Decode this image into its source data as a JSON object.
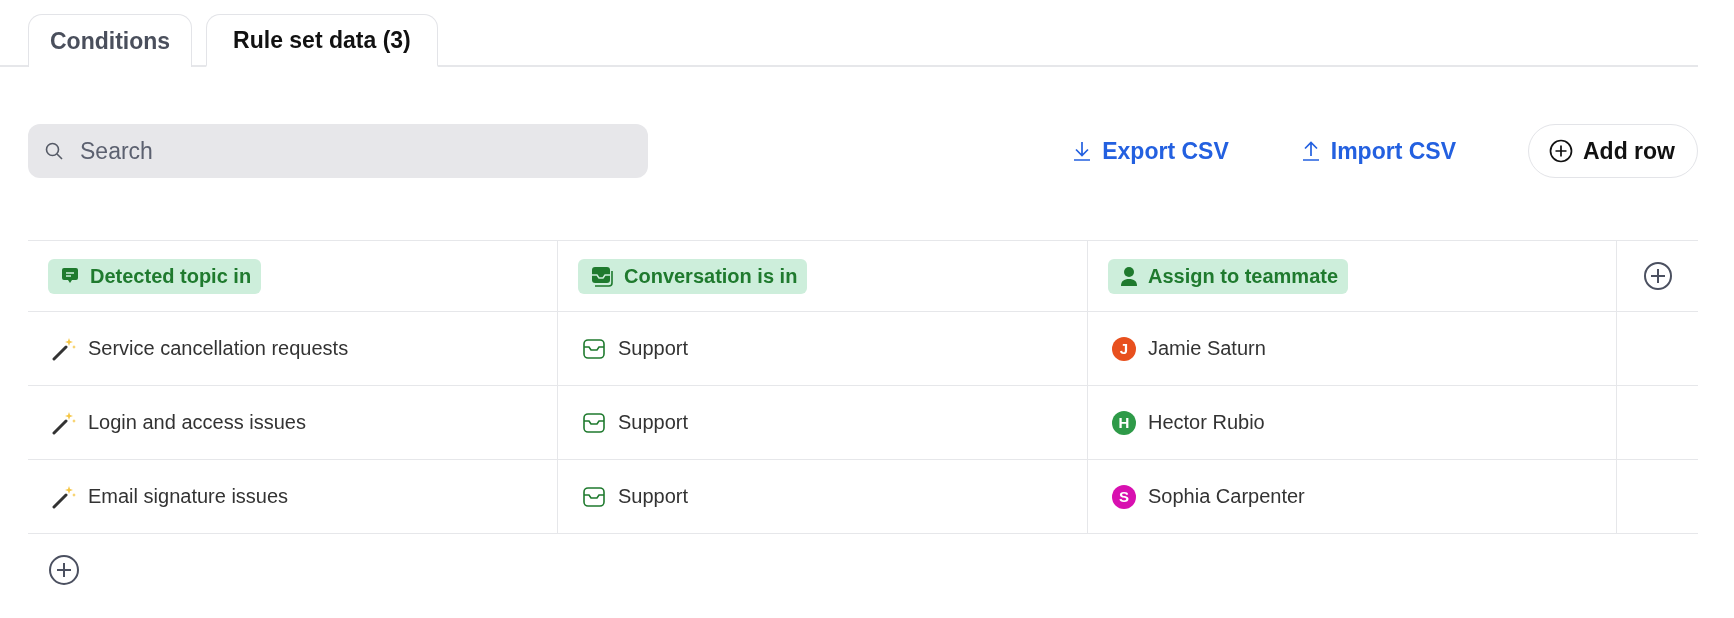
{
  "tabs": [
    {
      "label": "Conditions",
      "selected": false
    },
    {
      "label": "Rule set data (3)",
      "selected": true
    }
  ],
  "search": {
    "placeholder": "Search"
  },
  "actions": [
    {
      "kind": "export",
      "label": "Export CSV"
    },
    {
      "kind": "import",
      "label": "Import CSV"
    },
    {
      "kind": "add",
      "label": "Add row"
    }
  ],
  "table": {
    "columns": [
      {
        "kind": "topic",
        "label": "Detected topic in"
      },
      {
        "kind": "inbox",
        "label": "Conversation is in"
      },
      {
        "kind": "teammate",
        "label": "Assign to teammate"
      }
    ],
    "rows": [
      [
        {
          "text": "Service cancellation requests"
        },
        {
          "text": "Support"
        },
        {
          "text": "Jamie Saturn",
          "initial": "J",
          "color": "#e8501e"
        }
      ],
      [
        {
          "text": "Login and access issues"
        },
        {
          "text": "Support"
        },
        {
          "text": "Hector Rubio",
          "initial": "H",
          "color": "#2e9a48"
        }
      ],
      [
        {
          "text": "Email signature issues"
        },
        {
          "text": "Support"
        },
        {
          "text": "Sophia Carpenter",
          "initial": "S",
          "color": "#d810b0"
        }
      ]
    ]
  }
}
